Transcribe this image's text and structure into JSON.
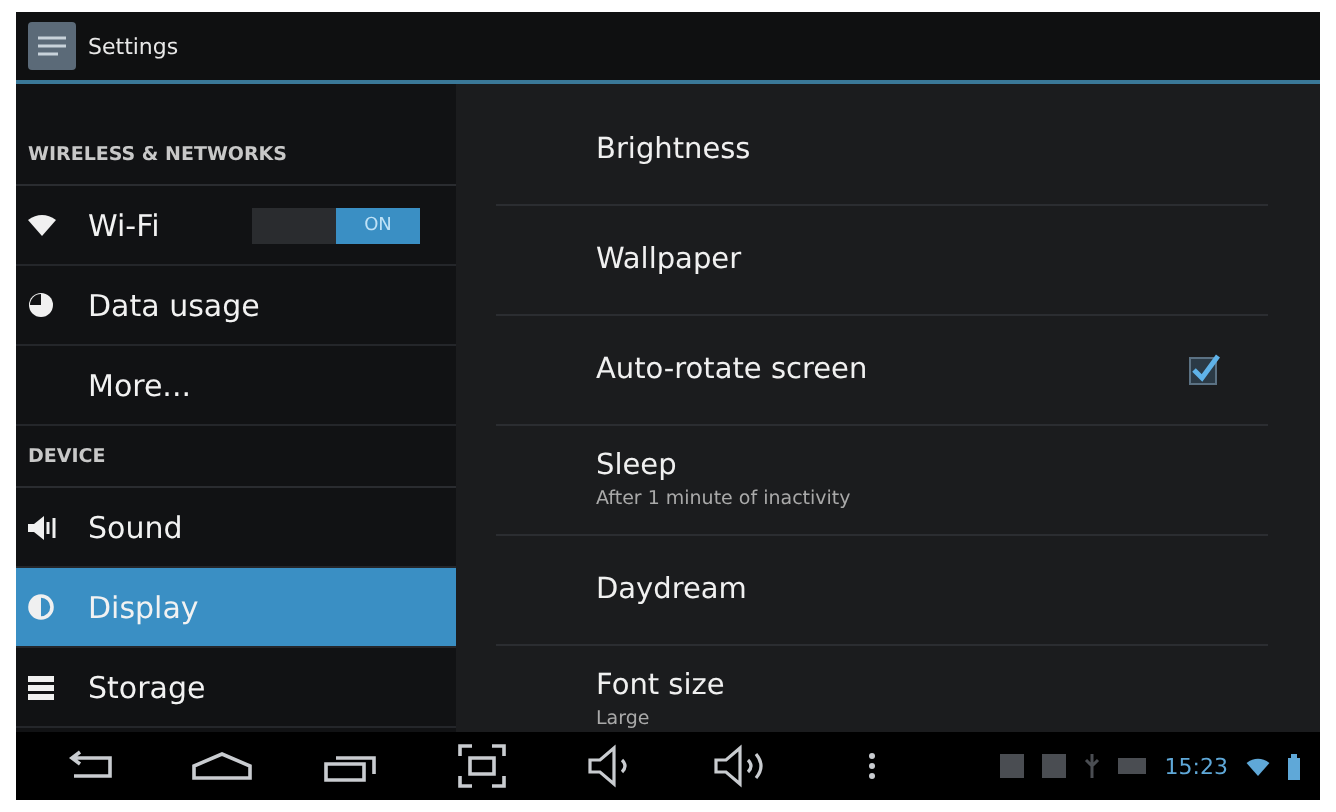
{
  "window": {
    "title": "Settings"
  },
  "sidebar": {
    "items": [
      {
        "kind": "header",
        "label": "WIRELESS & NETWORKS"
      },
      {
        "kind": "item",
        "label": "Wi-Fi",
        "selected": false,
        "toggle": {
          "on": true,
          "label": "ON"
        }
      },
      {
        "kind": "item",
        "label": "Data usage",
        "selected": false
      },
      {
        "kind": "item",
        "label": "More...",
        "selected": false
      },
      {
        "kind": "header",
        "label": "DEVICE"
      },
      {
        "kind": "item",
        "label": "Sound",
        "selected": false
      },
      {
        "kind": "item",
        "label": "Display",
        "selected": true
      },
      {
        "kind": "item",
        "label": "Storage",
        "selected": false
      }
    ]
  },
  "content": {
    "items": [
      {
        "title": "Brightness"
      },
      {
        "title": "Wallpaper"
      },
      {
        "title": "Auto-rotate screen",
        "checked": true
      },
      {
        "title": "Sleep",
        "summary": "After 1 minute of inactivity"
      },
      {
        "title": "Daydream"
      },
      {
        "title": "Font size",
        "summary": "Large"
      }
    ]
  },
  "status_bar": {
    "time": "15:23"
  }
}
